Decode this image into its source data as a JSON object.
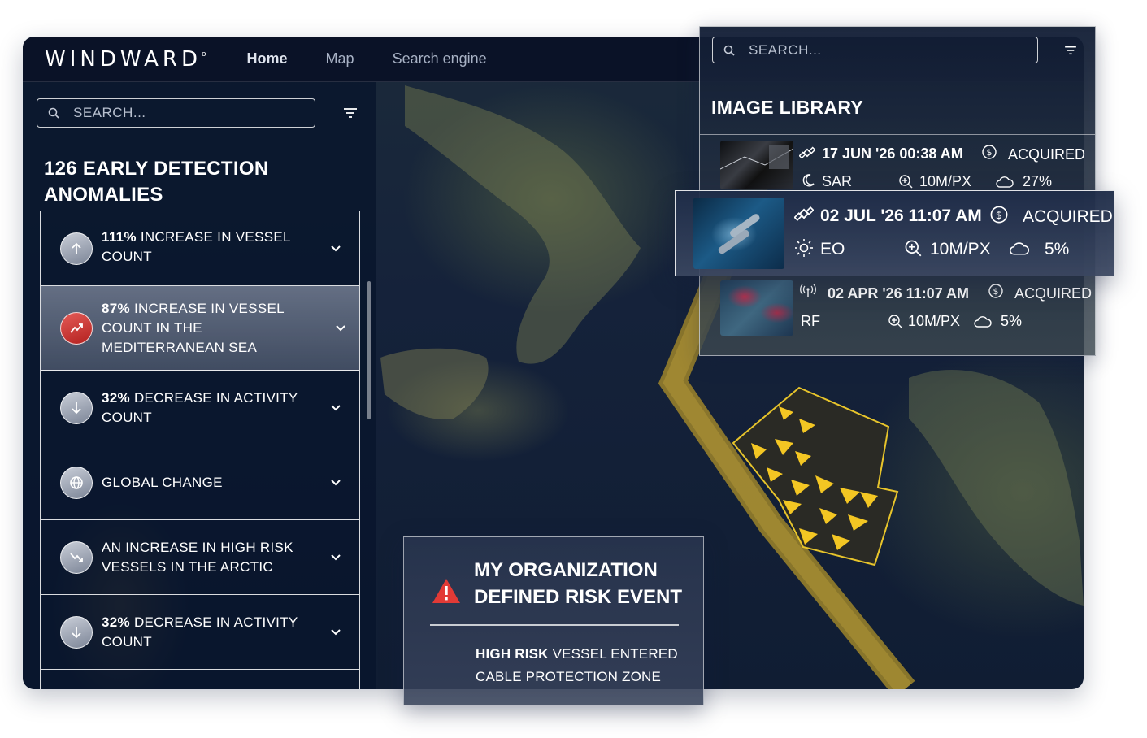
{
  "app": {
    "brand": "WINDWARD",
    "brand_mark": "o",
    "nav": [
      "Home",
      "Map",
      "Search engine"
    ]
  },
  "sidebar": {
    "search_placeholder": "SEARCH...",
    "title": "126 EARLY DETECTION ANOMALIES",
    "items": [
      {
        "bold": "111%",
        "text": " INCREASE IN VESSEL COUNT",
        "icon": "trend-up-icon"
      },
      {
        "bold": "87%",
        "text": " INCREASE IN VESSEL COUNT IN THE MEDITERRANEAN SEA",
        "icon": "trend-chart-icon"
      },
      {
        "bold": "32%",
        "text": " DECREASE IN ACTIVITY COUNT",
        "icon": "trend-down-icon"
      },
      {
        "bold": "",
        "text": "GLOBAL CHANGE",
        "icon": "globe-icon"
      },
      {
        "bold": "",
        "text": "AN INCREASE IN HIGH RISK VESSELS IN THE ARCTIC",
        "icon": "risk-chart-icon"
      },
      {
        "bold": "32%",
        "text": " DECREASE IN ACTIVITY COUNT",
        "icon": "trend-down-icon"
      }
    ]
  },
  "risk_event": {
    "title": "MY ORGANIZATION DEFINED RISK EVENT",
    "body_bold": "HIGH RISK",
    "body_text": " VESSEL ENTERED CABLE PROTECTION ZONE"
  },
  "library": {
    "search_placeholder": "SEARCH...",
    "title": "IMAGE LIBRARY",
    "rows": [
      {
        "date": "17 JUN '26  00:38 AM",
        "status": "ACQUIRED",
        "type": "SAR",
        "resolution": "10M/PX",
        "cloud": "27%",
        "sensor_icon": "satellite-icon",
        "type_icon": "moon-icon"
      },
      {
        "date": "02 JUL '26  11:07 AM",
        "status": "ACQUIRED",
        "type": "EO",
        "resolution": "10M/PX",
        "cloud": "5%",
        "sensor_icon": "satellite-icon",
        "type_icon": "sun-icon"
      },
      {
        "date": "02 APR '26  11:07 AM",
        "status": "ACQUIRED",
        "type": "RF",
        "resolution": "10M/PX",
        "cloud": "5%",
        "sensor_icon": "radio-signal-icon",
        "type_icon": "none"
      }
    ]
  },
  "colors": {
    "accent_gold": "#b08d2a",
    "zone_fill": "#2b2b26",
    "vessel_yellow": "#f4c623",
    "alert_red": "#e23a36"
  }
}
